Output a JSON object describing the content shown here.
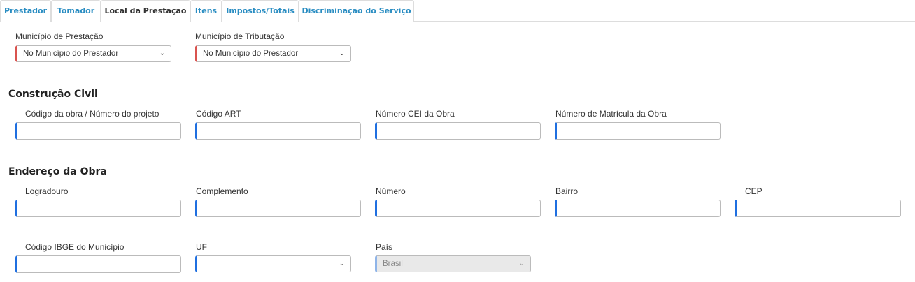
{
  "tabs": [
    "Prestador",
    "Tomador",
    "Local da Prestação",
    "Itens",
    "Impostos/Totais",
    "Discriminação do Serviço"
  ],
  "local": {
    "municipio_prestacao": {
      "label": "Município de Prestação",
      "value": "No Município do Prestador"
    },
    "municipio_tributacao": {
      "label": "Município de Tributação",
      "value": "No Município do Prestador"
    }
  },
  "construcao": {
    "title": "Construção Civil",
    "codigo_obra": "Código da obra / Número do projeto",
    "codigo_art": "Código ART",
    "numero_cei": "Número CEI da Obra",
    "matricula": "Número de Matrícula da Obra"
  },
  "endereco": {
    "title": "Endereço da Obra",
    "logradouro": "Logradouro",
    "complemento": "Complemento",
    "numero": "Número",
    "bairro": "Bairro",
    "cep": "CEP",
    "ibge": "Código IBGE do Município",
    "uf": {
      "label": "UF",
      "value": ""
    },
    "pais": {
      "label": "País",
      "value": "Brasil"
    }
  },
  "icons": {
    "dropdown": "chevron-down-icon"
  },
  "colors": {
    "tab_text": "#2a8dc2",
    "required_marker": "#d9534f",
    "field_marker": "#1f6fe0"
  }
}
